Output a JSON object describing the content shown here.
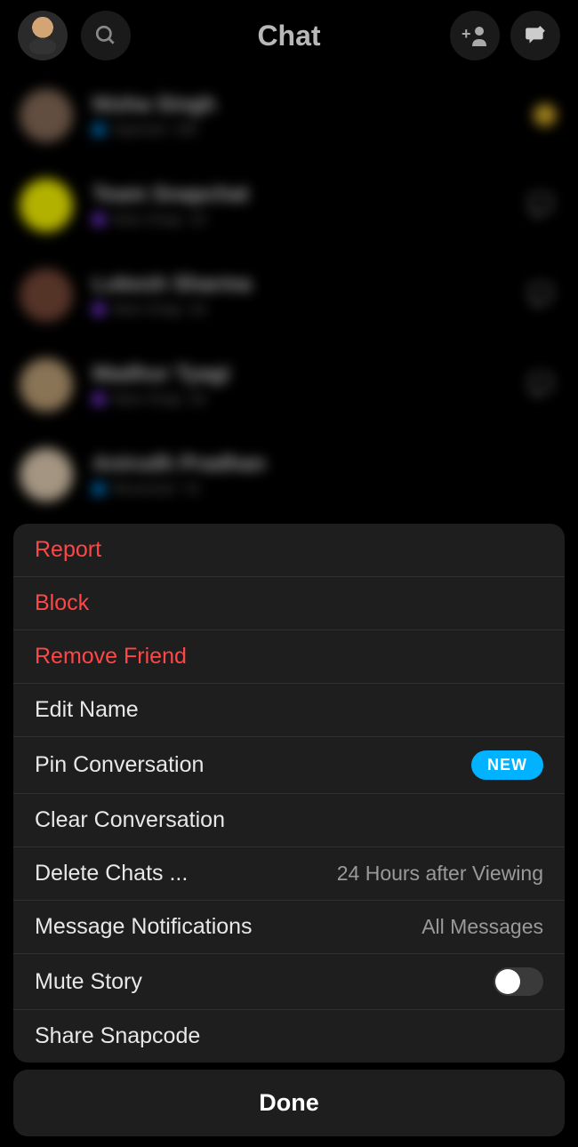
{
  "header": {
    "title": "Chat"
  },
  "chats": [
    {
      "name": "Nisha Singh",
      "status": "Opened",
      "time": "19h",
      "avatar_bg": "#8b6f5c",
      "dot_color": "#0099ff"
    },
    {
      "name": "Team Snapchat",
      "status": "New Snap",
      "time": "1d",
      "avatar_bg": "#fffc00",
      "dot_color": "#8b3dff"
    },
    {
      "name": "Lokesh Sharma",
      "status": "New Snap",
      "time": "2d",
      "avatar_bg": "#7a4a3a",
      "dot_color": "#8b3dff"
    },
    {
      "name": "Madhur Tyagi",
      "status": "New Snap",
      "time": "2d",
      "avatar_bg": "#c4a57b",
      "dot_color": "#8b3dff"
    },
    {
      "name": "Anirudh Pradhan",
      "status": "Received",
      "time": "7d",
      "avatar_bg": "#e8d4b8",
      "dot_color": "#0099ff"
    }
  ],
  "action_sheet": {
    "items": [
      {
        "label": "Report",
        "type": "danger"
      },
      {
        "label": "Block",
        "type": "danger"
      },
      {
        "label": "Remove Friend",
        "type": "danger"
      },
      {
        "label": "Edit Name",
        "type": "normal"
      },
      {
        "label": "Pin Conversation",
        "type": "normal",
        "badge": "NEW"
      },
      {
        "label": "Clear Conversation",
        "type": "normal"
      },
      {
        "label": "Delete Chats ...",
        "type": "normal",
        "meta": "24 Hours after Viewing"
      },
      {
        "label": "Message Notifications",
        "type": "normal",
        "meta": "All Messages"
      },
      {
        "label": "Mute Story",
        "type": "normal",
        "toggle": false
      },
      {
        "label": "Share Snapcode",
        "type": "normal"
      }
    ]
  },
  "done_button": {
    "label": "Done"
  }
}
